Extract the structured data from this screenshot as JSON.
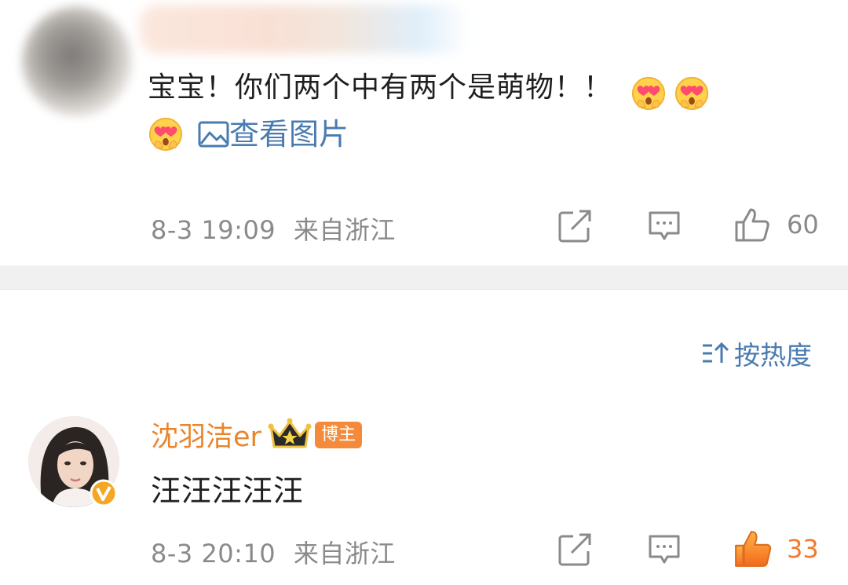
{
  "comments": [
    {
      "text": "宝宝！你们两个中有两个是萌物！！",
      "emoji": "heart-eyes-face-emoji",
      "view_image": "查看图片",
      "time": "8-3 19:09",
      "location": "来自浙江",
      "likes": "60",
      "liked": false
    },
    {
      "username": "沈羽洁er",
      "badge": "博主",
      "text": "汪汪汪汪汪",
      "time": "8-3 20:10",
      "location": "来自浙江",
      "likes": "33",
      "liked": true
    }
  ],
  "sort_label": "按热度",
  "colors": {
    "link": "#4a7bb0",
    "username": "#e8862d",
    "liked": "#f07a2d",
    "meta": "#8a8a8a",
    "divider": "#f0f0f0"
  }
}
